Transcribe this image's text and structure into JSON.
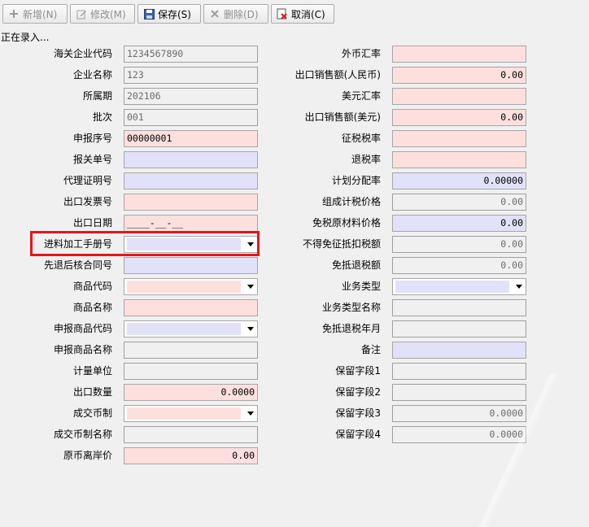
{
  "toolbar": {
    "add": "新增(N)",
    "edit": "修改(M)",
    "save": "保存(S)",
    "delete": "删除(D)",
    "cancel": "取消(C)"
  },
  "status": "正在录入...",
  "left": [
    {
      "label": "海关企业代码",
      "value": "1234567890",
      "style": "gray"
    },
    {
      "label": "企业名称",
      "value": "123",
      "style": "gray"
    },
    {
      "label": "所属期",
      "value": "202106",
      "style": "gray"
    },
    {
      "label": "批次",
      "value": "001",
      "style": "gray"
    },
    {
      "label": "申报序号",
      "value": "00000001",
      "style": "pink"
    },
    {
      "label": "报关单号",
      "value": "",
      "style": "blue"
    },
    {
      "label": "代理证明号",
      "value": "",
      "style": "blue"
    },
    {
      "label": "出口发票号",
      "value": "",
      "style": "pink"
    },
    {
      "label": "出口日期",
      "value": "____-__-__",
      "style": "pink"
    },
    {
      "label": "进料加工手册号",
      "value": "",
      "style": "combo-blue"
    },
    {
      "label": "先退后核合同号",
      "value": "",
      "style": "blue"
    },
    {
      "label": "商品代码",
      "value": "",
      "style": "combo-pink"
    },
    {
      "label": "商品名称",
      "value": "",
      "style": "pink"
    },
    {
      "label": "申报商品代码",
      "value": "",
      "style": "combo-blue"
    },
    {
      "label": "申报商品名称",
      "value": "",
      "style": "gray"
    },
    {
      "label": "计量单位",
      "value": "",
      "style": "gray"
    },
    {
      "label": "出口数量",
      "value": "0.0000",
      "style": "pink-right"
    },
    {
      "label": "成交币制",
      "value": "",
      "style": "combo-pink"
    },
    {
      "label": "成交币制名称",
      "value": "",
      "style": "gray"
    },
    {
      "label": "原币离岸价",
      "value": "0.00",
      "style": "pink-right"
    }
  ],
  "right": [
    {
      "label": "外币汇率",
      "value": "",
      "style": "pink"
    },
    {
      "label": "出口销售额(人民币)",
      "value": "0.00",
      "style": "pink-right"
    },
    {
      "label": "美元汇率",
      "value": "",
      "style": "pink"
    },
    {
      "label": "出口销售额(美元)",
      "value": "0.00",
      "style": "pink-right"
    },
    {
      "label": "征税税率",
      "value": "",
      "style": "pink"
    },
    {
      "label": "退税率",
      "value": "",
      "style": "pink"
    },
    {
      "label": "计划分配率",
      "value": "0.00000",
      "style": "blue-right"
    },
    {
      "label": "组成计税价格",
      "value": "0.00",
      "style": "gray-right"
    },
    {
      "label": "免税原材料价格",
      "value": "0.00",
      "style": "blue-right"
    },
    {
      "label": "不得免征抵扣税额",
      "value": "0.00",
      "style": "gray-right"
    },
    {
      "label": "免抵退税额",
      "value": "0.00",
      "style": "gray-right"
    },
    {
      "label": "业务类型",
      "value": "",
      "style": "combo-blue"
    },
    {
      "label": "业务类型名称",
      "value": "",
      "style": "gray"
    },
    {
      "label": "免抵退税年月",
      "value": "",
      "style": "gray"
    },
    {
      "label": "备注",
      "value": "",
      "style": "blue"
    },
    {
      "label": "保留字段1",
      "value": "",
      "style": "gray"
    },
    {
      "label": "保留字段2",
      "value": "",
      "style": "gray"
    },
    {
      "label": "保留字段3",
      "value": "0.0000",
      "style": "gray-right"
    },
    {
      "label": "保留字段4",
      "value": "0.0000",
      "style": "gray-right"
    }
  ]
}
